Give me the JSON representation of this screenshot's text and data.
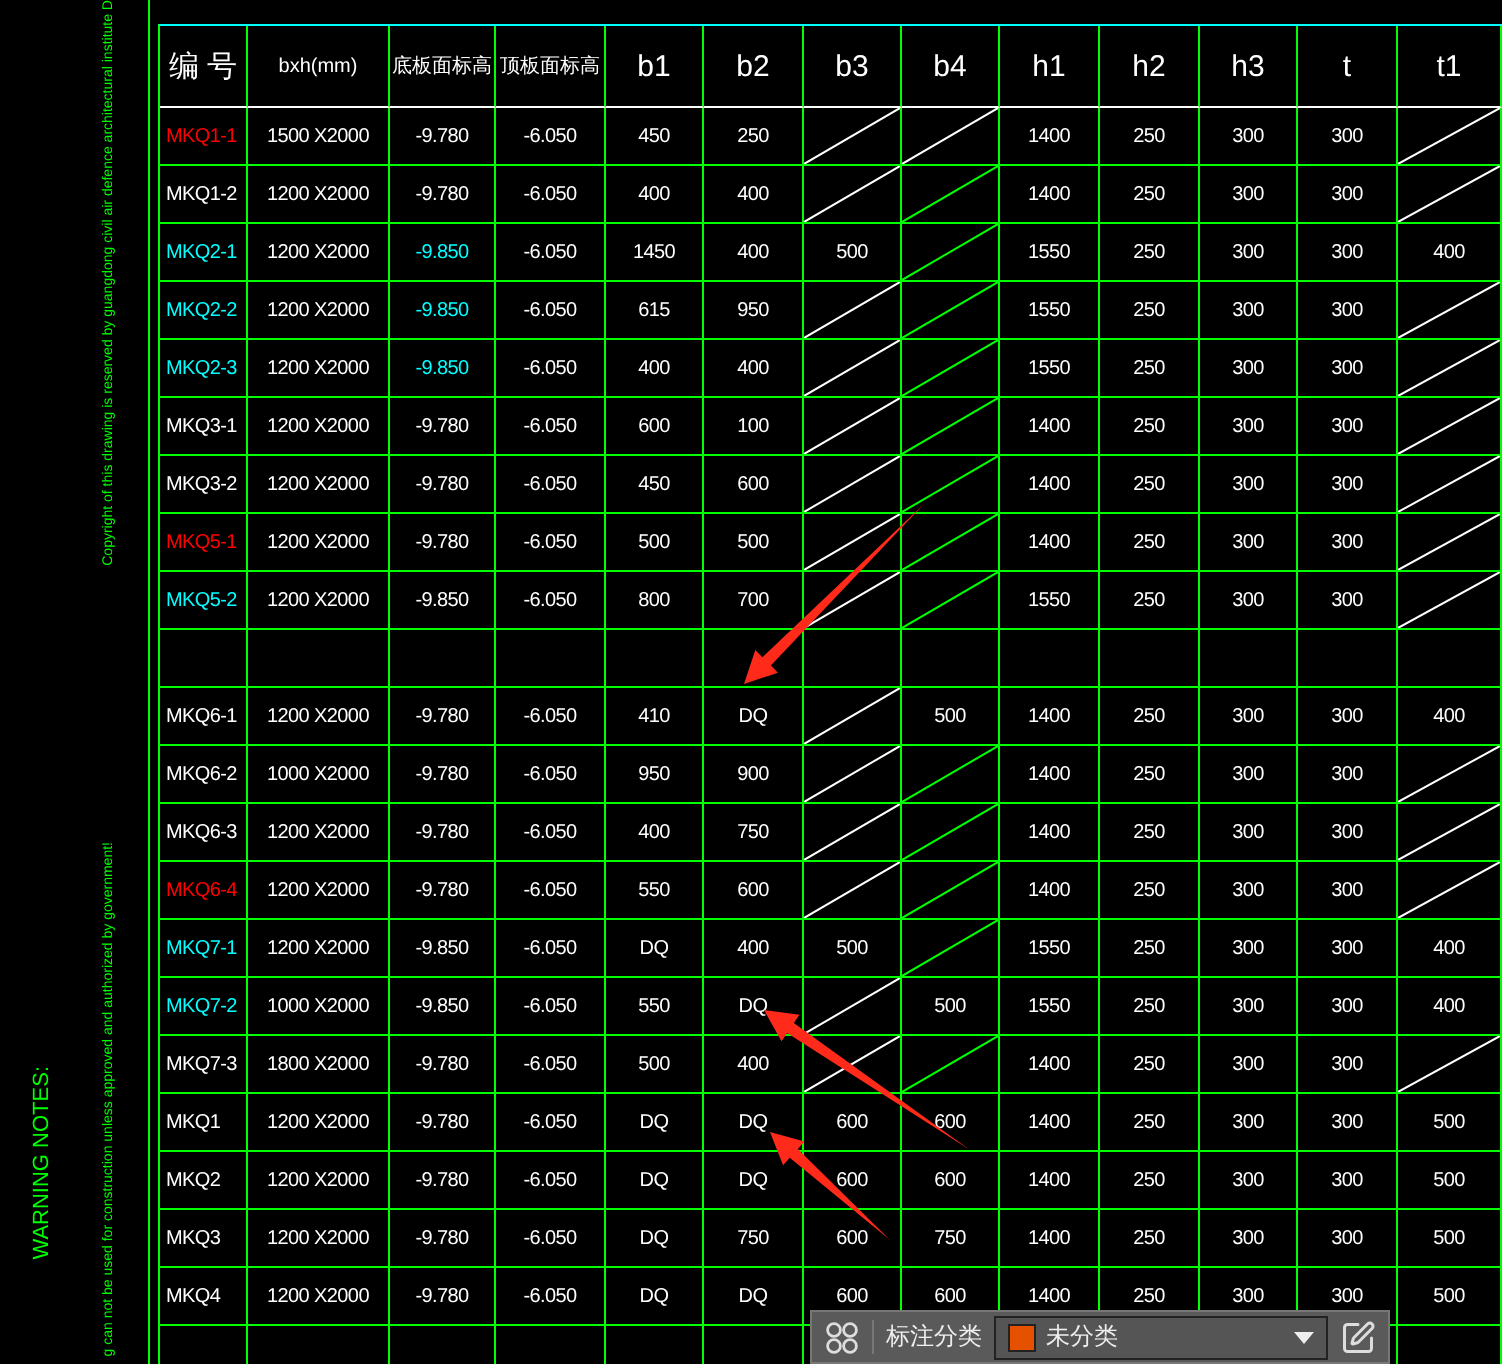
{
  "side_notes": {
    "copyright": "Copyright of this drawing is reserved by guangdong civil air defence architectural institute D",
    "warning_title": "WARNING NOTES:",
    "warning_text": "g can not be used for construction unless approved and authorized by government!"
  },
  "table": {
    "columns": [
      "编 号",
      "bxh(mm)",
      "底板面标高",
      "顶板面标高",
      "b1",
      "b2",
      "b3",
      "b4",
      "h1",
      "h2",
      "h3",
      "t",
      "t1"
    ],
    "rows": [
      {
        "kind": "data",
        "cells": [
          {
            "kind": "text",
            "text": "MKQ1-1",
            "color": "#ff0000"
          },
          {
            "kind": "text",
            "text": "1500 X2000",
            "color": "#ffffff"
          },
          {
            "kind": "text",
            "text": "-9.780",
            "color": "#ffffff"
          },
          {
            "kind": "text",
            "text": "-6.050",
            "color": "#ffffff"
          },
          {
            "kind": "text",
            "text": "450",
            "color": "#ffffff"
          },
          {
            "kind": "text",
            "text": "250",
            "color": "#ffffff"
          },
          {
            "kind": "slash",
            "color": "#ffffff"
          },
          {
            "kind": "slash",
            "color": "#ffffff"
          },
          {
            "kind": "text",
            "text": "1400",
            "color": "#ffffff"
          },
          {
            "kind": "text",
            "text": "250",
            "color": "#ffffff"
          },
          {
            "kind": "text",
            "text": "300",
            "color": "#ffffff"
          },
          {
            "kind": "text",
            "text": "300",
            "color": "#ffffff"
          },
          {
            "kind": "slash",
            "color": "#ffffff"
          }
        ]
      },
      {
        "kind": "data",
        "cells": [
          {
            "kind": "text",
            "text": "MKQ1-2",
            "color": "#ffffff"
          },
          {
            "kind": "text",
            "text": "1200 X2000",
            "color": "#ffffff"
          },
          {
            "kind": "text",
            "text": "-9.780",
            "color": "#ffffff"
          },
          {
            "kind": "text",
            "text": "-6.050",
            "color": "#ffffff"
          },
          {
            "kind": "text",
            "text": "400",
            "color": "#ffffff"
          },
          {
            "kind": "text",
            "text": "400",
            "color": "#ffffff"
          },
          {
            "kind": "slash",
            "color": "#ffffff"
          },
          {
            "kind": "slash",
            "color": "#00ff00"
          },
          {
            "kind": "text",
            "text": "1400",
            "color": "#ffffff"
          },
          {
            "kind": "text",
            "text": "250",
            "color": "#ffffff"
          },
          {
            "kind": "text",
            "text": "300",
            "color": "#ffffff"
          },
          {
            "kind": "text",
            "text": "300",
            "color": "#ffffff"
          },
          {
            "kind": "slash",
            "color": "#ffffff"
          }
        ]
      },
      {
        "kind": "data",
        "cells": [
          {
            "kind": "text",
            "text": "MKQ2-1",
            "color": "#00ffff"
          },
          {
            "kind": "text",
            "text": "1200 X2000",
            "color": "#ffffff"
          },
          {
            "kind": "text",
            "text": "-9.850",
            "color": "#00ffff"
          },
          {
            "kind": "text",
            "text": "-6.050",
            "color": "#ffffff"
          },
          {
            "kind": "text",
            "text": "1450",
            "color": "#ffffff"
          },
          {
            "kind": "text",
            "text": "400",
            "color": "#ffffff"
          },
          {
            "kind": "text",
            "text": "500",
            "color": "#ffffff"
          },
          {
            "kind": "slash",
            "color": "#00ff00"
          },
          {
            "kind": "text",
            "text": "1550",
            "color": "#ffffff"
          },
          {
            "kind": "text",
            "text": "250",
            "color": "#ffffff"
          },
          {
            "kind": "text",
            "text": "300",
            "color": "#ffffff"
          },
          {
            "kind": "text",
            "text": "300",
            "color": "#ffffff"
          },
          {
            "kind": "text",
            "text": "400",
            "color": "#ffffff"
          }
        ]
      },
      {
        "kind": "data",
        "cells": [
          {
            "kind": "text",
            "text": "MKQ2-2",
            "color": "#00ffff"
          },
          {
            "kind": "text",
            "text": "1200 X2000",
            "color": "#ffffff"
          },
          {
            "kind": "text",
            "text": "-9.850",
            "color": "#00ffff"
          },
          {
            "kind": "text",
            "text": "-6.050",
            "color": "#ffffff"
          },
          {
            "kind": "text",
            "text": "615",
            "color": "#ffffff"
          },
          {
            "kind": "text",
            "text": "950",
            "color": "#ffffff"
          },
          {
            "kind": "slash",
            "color": "#ffffff"
          },
          {
            "kind": "slash",
            "color": "#00ff00"
          },
          {
            "kind": "text",
            "text": "1550",
            "color": "#ffffff"
          },
          {
            "kind": "text",
            "text": "250",
            "color": "#ffffff"
          },
          {
            "kind": "text",
            "text": "300",
            "color": "#ffffff"
          },
          {
            "kind": "text",
            "text": "300",
            "color": "#ffffff"
          },
          {
            "kind": "slash",
            "color": "#ffffff"
          }
        ]
      },
      {
        "kind": "data",
        "cells": [
          {
            "kind": "text",
            "text": "MKQ2-3",
            "color": "#00ffff"
          },
          {
            "kind": "text",
            "text": "1200 X2000",
            "color": "#ffffff"
          },
          {
            "kind": "text",
            "text": "-9.850",
            "color": "#00ffff"
          },
          {
            "kind": "text",
            "text": "-6.050",
            "color": "#ffffff"
          },
          {
            "kind": "text",
            "text": "400",
            "color": "#ffffff"
          },
          {
            "kind": "text",
            "text": "400",
            "color": "#ffffff"
          },
          {
            "kind": "slash",
            "color": "#ffffff"
          },
          {
            "kind": "slash",
            "color": "#00ff00"
          },
          {
            "kind": "text",
            "text": "1550",
            "color": "#ffffff"
          },
          {
            "kind": "text",
            "text": "250",
            "color": "#ffffff"
          },
          {
            "kind": "text",
            "text": "300",
            "color": "#ffffff"
          },
          {
            "kind": "text",
            "text": "300",
            "color": "#ffffff"
          },
          {
            "kind": "slash",
            "color": "#ffffff"
          }
        ]
      },
      {
        "kind": "data",
        "cells": [
          {
            "kind": "text",
            "text": "MKQ3-1",
            "color": "#ffffff"
          },
          {
            "kind": "text",
            "text": "1200 X2000",
            "color": "#ffffff"
          },
          {
            "kind": "text",
            "text": "-9.780",
            "color": "#ffffff"
          },
          {
            "kind": "text",
            "text": "-6.050",
            "color": "#ffffff"
          },
          {
            "kind": "text",
            "text": "600",
            "color": "#ffffff"
          },
          {
            "kind": "text",
            "text": "100",
            "color": "#ffffff"
          },
          {
            "kind": "slash",
            "color": "#ffffff"
          },
          {
            "kind": "slash",
            "color": "#00ff00"
          },
          {
            "kind": "text",
            "text": "1400",
            "color": "#ffffff"
          },
          {
            "kind": "text",
            "text": "250",
            "color": "#ffffff"
          },
          {
            "kind": "text",
            "text": "300",
            "color": "#ffffff"
          },
          {
            "kind": "text",
            "text": "300",
            "color": "#ffffff"
          },
          {
            "kind": "slash",
            "color": "#ffffff"
          }
        ]
      },
      {
        "kind": "data",
        "cells": [
          {
            "kind": "text",
            "text": "MKQ3-2",
            "color": "#ffffff"
          },
          {
            "kind": "text",
            "text": "1200 X2000",
            "color": "#ffffff"
          },
          {
            "kind": "text",
            "text": "-9.780",
            "color": "#ffffff"
          },
          {
            "kind": "text",
            "text": "-6.050",
            "color": "#ffffff"
          },
          {
            "kind": "text",
            "text": "450",
            "color": "#ffffff"
          },
          {
            "kind": "text",
            "text": "600",
            "color": "#ffffff"
          },
          {
            "kind": "slash",
            "color": "#ffffff"
          },
          {
            "kind": "slash",
            "color": "#00ff00"
          },
          {
            "kind": "text",
            "text": "1400",
            "color": "#ffffff"
          },
          {
            "kind": "text",
            "text": "250",
            "color": "#ffffff"
          },
          {
            "kind": "text",
            "text": "300",
            "color": "#ffffff"
          },
          {
            "kind": "text",
            "text": "300",
            "color": "#ffffff"
          },
          {
            "kind": "slash",
            "color": "#ffffff"
          }
        ]
      },
      {
        "kind": "data",
        "cells": [
          {
            "kind": "text",
            "text": "MKQ5-1",
            "color": "#ff0000"
          },
          {
            "kind": "text",
            "text": "1200 X2000",
            "color": "#ffffff"
          },
          {
            "kind": "text",
            "text": "-9.780",
            "color": "#ffffff"
          },
          {
            "kind": "text",
            "text": "-6.050",
            "color": "#ffffff"
          },
          {
            "kind": "text",
            "text": "500",
            "color": "#ffffff"
          },
          {
            "kind": "text",
            "text": "500",
            "color": "#ffffff"
          },
          {
            "kind": "slash",
            "color": "#ffffff"
          },
          {
            "kind": "slash",
            "color": "#00ff00"
          },
          {
            "kind": "text",
            "text": "1400",
            "color": "#ffffff"
          },
          {
            "kind": "text",
            "text": "250",
            "color": "#ffffff"
          },
          {
            "kind": "text",
            "text": "300",
            "color": "#ffffff"
          },
          {
            "kind": "text",
            "text": "300",
            "color": "#ffffff"
          },
          {
            "kind": "slash",
            "color": "#ffffff"
          }
        ]
      },
      {
        "kind": "data",
        "cells": [
          {
            "kind": "text",
            "text": "MKQ5-2",
            "color": "#00ffff"
          },
          {
            "kind": "text",
            "text": "1200 X2000",
            "color": "#ffffff"
          },
          {
            "kind": "text",
            "text": "-9.850",
            "color": "#ffffff"
          },
          {
            "kind": "text",
            "text": "-6.050",
            "color": "#ffffff"
          },
          {
            "kind": "text",
            "text": "800",
            "color": "#ffffff"
          },
          {
            "kind": "text",
            "text": "700",
            "color": "#ffffff"
          },
          {
            "kind": "slash",
            "color": "#ffffff"
          },
          {
            "kind": "slash",
            "color": "#00ff00"
          },
          {
            "kind": "text",
            "text": "1550",
            "color": "#ffffff"
          },
          {
            "kind": "text",
            "text": "250",
            "color": "#ffffff"
          },
          {
            "kind": "text",
            "text": "300",
            "color": "#ffffff"
          },
          {
            "kind": "text",
            "text": "300",
            "color": "#ffffff"
          },
          {
            "kind": "slash",
            "color": "#ffffff"
          }
        ]
      },
      {
        "kind": "blank"
      },
      {
        "kind": "data",
        "cells": [
          {
            "kind": "text",
            "text": "MKQ6-1",
            "color": "#ffffff"
          },
          {
            "kind": "text",
            "text": "1200 X2000",
            "color": "#ffffff"
          },
          {
            "kind": "text",
            "text": "-9.780",
            "color": "#ffffff"
          },
          {
            "kind": "text",
            "text": "-6.050",
            "color": "#ffffff"
          },
          {
            "kind": "text",
            "text": "410",
            "color": "#ffffff"
          },
          {
            "kind": "text",
            "text": "DQ",
            "color": "#ffffff"
          },
          {
            "kind": "slash",
            "color": "#ffffff"
          },
          {
            "kind": "text",
            "text": "500",
            "color": "#ffffff"
          },
          {
            "kind": "text",
            "text": "1400",
            "color": "#ffffff"
          },
          {
            "kind": "text",
            "text": "250",
            "color": "#ffffff"
          },
          {
            "kind": "text",
            "text": "300",
            "color": "#ffffff"
          },
          {
            "kind": "text",
            "text": "300",
            "color": "#ffffff"
          },
          {
            "kind": "text",
            "text": "400",
            "color": "#ffffff"
          }
        ]
      },
      {
        "kind": "data",
        "cells": [
          {
            "kind": "text",
            "text": "MKQ6-2",
            "color": "#ffffff"
          },
          {
            "kind": "text",
            "text": "1000 X2000",
            "color": "#ffffff"
          },
          {
            "kind": "text",
            "text": "-9.780",
            "color": "#ffffff"
          },
          {
            "kind": "text",
            "text": "-6.050",
            "color": "#ffffff"
          },
          {
            "kind": "text",
            "text": "950",
            "color": "#ffffff"
          },
          {
            "kind": "text",
            "text": "900",
            "color": "#ffffff"
          },
          {
            "kind": "slash",
            "color": "#ffffff"
          },
          {
            "kind": "slash",
            "color": "#00ff00"
          },
          {
            "kind": "text",
            "text": "1400",
            "color": "#ffffff"
          },
          {
            "kind": "text",
            "text": "250",
            "color": "#ffffff"
          },
          {
            "kind": "text",
            "text": "300",
            "color": "#ffffff"
          },
          {
            "kind": "text",
            "text": "300",
            "color": "#ffffff"
          },
          {
            "kind": "slash",
            "color": "#ffffff"
          }
        ]
      },
      {
        "kind": "data",
        "cells": [
          {
            "kind": "text",
            "text": "MKQ6-3",
            "color": "#ffffff"
          },
          {
            "kind": "text",
            "text": "1200 X2000",
            "color": "#ffffff"
          },
          {
            "kind": "text",
            "text": "-9.780",
            "color": "#ffffff"
          },
          {
            "kind": "text",
            "text": "-6.050",
            "color": "#ffffff"
          },
          {
            "kind": "text",
            "text": "400",
            "color": "#ffffff"
          },
          {
            "kind": "text",
            "text": "750",
            "color": "#ffffff"
          },
          {
            "kind": "slash",
            "color": "#ffffff"
          },
          {
            "kind": "slash",
            "color": "#00ff00"
          },
          {
            "kind": "text",
            "text": "1400",
            "color": "#ffffff"
          },
          {
            "kind": "text",
            "text": "250",
            "color": "#ffffff"
          },
          {
            "kind": "text",
            "text": "300",
            "color": "#ffffff"
          },
          {
            "kind": "text",
            "text": "300",
            "color": "#ffffff"
          },
          {
            "kind": "slash",
            "color": "#ffffff"
          }
        ]
      },
      {
        "kind": "data",
        "cells": [
          {
            "kind": "text",
            "text": "MKQ6-4",
            "color": "#ff0000"
          },
          {
            "kind": "text",
            "text": "1200 X2000",
            "color": "#ffffff"
          },
          {
            "kind": "text",
            "text": "-9.780",
            "color": "#ffffff"
          },
          {
            "kind": "text",
            "text": "-6.050",
            "color": "#ffffff"
          },
          {
            "kind": "text",
            "text": "550",
            "color": "#ffffff"
          },
          {
            "kind": "text",
            "text": "600",
            "color": "#ffffff"
          },
          {
            "kind": "slash",
            "color": "#ffffff"
          },
          {
            "kind": "slash",
            "color": "#00ff00"
          },
          {
            "kind": "text",
            "text": "1400",
            "color": "#ffffff"
          },
          {
            "kind": "text",
            "text": "250",
            "color": "#ffffff"
          },
          {
            "kind": "text",
            "text": "300",
            "color": "#ffffff"
          },
          {
            "kind": "text",
            "text": "300",
            "color": "#ffffff"
          },
          {
            "kind": "slash",
            "color": "#ffffff"
          }
        ]
      },
      {
        "kind": "data",
        "cells": [
          {
            "kind": "text",
            "text": "MKQ7-1",
            "color": "#00ffff"
          },
          {
            "kind": "text",
            "text": "1200 X2000",
            "color": "#ffffff"
          },
          {
            "kind": "text",
            "text": "-9.850",
            "color": "#ffffff"
          },
          {
            "kind": "text",
            "text": "-6.050",
            "color": "#ffffff"
          },
          {
            "kind": "text",
            "text": "DQ",
            "color": "#ffffff"
          },
          {
            "kind": "text",
            "text": "400",
            "color": "#ffffff"
          },
          {
            "kind": "text",
            "text": "500",
            "color": "#ffffff"
          },
          {
            "kind": "slash",
            "color": "#00ff00"
          },
          {
            "kind": "text",
            "text": "1550",
            "color": "#ffffff"
          },
          {
            "kind": "text",
            "text": "250",
            "color": "#ffffff"
          },
          {
            "kind": "text",
            "text": "300",
            "color": "#ffffff"
          },
          {
            "kind": "text",
            "text": "300",
            "color": "#ffffff"
          },
          {
            "kind": "text",
            "text": "400",
            "color": "#ffffff"
          }
        ]
      },
      {
        "kind": "data",
        "cells": [
          {
            "kind": "text",
            "text": "MKQ7-2",
            "color": "#00ffff"
          },
          {
            "kind": "text",
            "text": "1000 X2000",
            "color": "#ffffff"
          },
          {
            "kind": "text",
            "text": "-9.850",
            "color": "#ffffff"
          },
          {
            "kind": "text",
            "text": "-6.050",
            "color": "#ffffff"
          },
          {
            "kind": "text",
            "text": "550",
            "color": "#ffffff"
          },
          {
            "kind": "text",
            "text": "DQ",
            "color": "#ffffff"
          },
          {
            "kind": "slash",
            "color": "#ffffff"
          },
          {
            "kind": "text",
            "text": "500",
            "color": "#ffffff"
          },
          {
            "kind": "text",
            "text": "1550",
            "color": "#ffffff"
          },
          {
            "kind": "text",
            "text": "250",
            "color": "#ffffff"
          },
          {
            "kind": "text",
            "text": "300",
            "color": "#ffffff"
          },
          {
            "kind": "text",
            "text": "300",
            "color": "#ffffff"
          },
          {
            "kind": "text",
            "text": "400",
            "color": "#ffffff"
          }
        ]
      },
      {
        "kind": "data",
        "cells": [
          {
            "kind": "text",
            "text": "MKQ7-3",
            "color": "#ffffff"
          },
          {
            "kind": "text",
            "text": "1800 X2000",
            "color": "#ffffff"
          },
          {
            "kind": "text",
            "text": "-9.780",
            "color": "#ffffff"
          },
          {
            "kind": "text",
            "text": "-6.050",
            "color": "#ffffff"
          },
          {
            "kind": "text",
            "text": "500",
            "color": "#ffffff"
          },
          {
            "kind": "text",
            "text": "400",
            "color": "#ffffff"
          },
          {
            "kind": "slash",
            "color": "#ffffff"
          },
          {
            "kind": "slash",
            "color": "#00ff00"
          },
          {
            "kind": "text",
            "text": "1400",
            "color": "#ffffff"
          },
          {
            "kind": "text",
            "text": "250",
            "color": "#ffffff"
          },
          {
            "kind": "text",
            "text": "300",
            "color": "#ffffff"
          },
          {
            "kind": "text",
            "text": "300",
            "color": "#ffffff"
          },
          {
            "kind": "slash",
            "color": "#ffffff"
          }
        ]
      },
      {
        "kind": "data",
        "cells": [
          {
            "kind": "text",
            "text": "MKQ1",
            "color": "#ffffff"
          },
          {
            "kind": "text",
            "text": "1200 X2000",
            "color": "#ffffff"
          },
          {
            "kind": "text",
            "text": "-9.780",
            "color": "#ffffff"
          },
          {
            "kind": "text",
            "text": "-6.050",
            "color": "#ffffff"
          },
          {
            "kind": "text",
            "text": "DQ",
            "color": "#ffffff"
          },
          {
            "kind": "text",
            "text": "DQ",
            "color": "#ffffff"
          },
          {
            "kind": "text",
            "text": "600",
            "color": "#ffffff"
          },
          {
            "kind": "text",
            "text": "600",
            "color": "#ffffff"
          },
          {
            "kind": "text",
            "text": "1400",
            "color": "#ffffff"
          },
          {
            "kind": "text",
            "text": "250",
            "color": "#ffffff"
          },
          {
            "kind": "text",
            "text": "300",
            "color": "#ffffff"
          },
          {
            "kind": "text",
            "text": "300",
            "color": "#ffffff"
          },
          {
            "kind": "text",
            "text": "500",
            "color": "#ffffff"
          }
        ]
      },
      {
        "kind": "data",
        "cells": [
          {
            "kind": "text",
            "text": "MKQ2",
            "color": "#ffffff"
          },
          {
            "kind": "text",
            "text": "1200 X2000",
            "color": "#ffffff"
          },
          {
            "kind": "text",
            "text": "-9.780",
            "color": "#ffffff"
          },
          {
            "kind": "text",
            "text": "-6.050",
            "color": "#ffffff"
          },
          {
            "kind": "text",
            "text": "DQ",
            "color": "#ffffff"
          },
          {
            "kind": "text",
            "text": "DQ",
            "color": "#ffffff"
          },
          {
            "kind": "text",
            "text": "600",
            "color": "#ffffff"
          },
          {
            "kind": "text",
            "text": "600",
            "color": "#ffffff"
          },
          {
            "kind": "text",
            "text": "1400",
            "color": "#ffffff"
          },
          {
            "kind": "text",
            "text": "250",
            "color": "#ffffff"
          },
          {
            "kind": "text",
            "text": "300",
            "color": "#ffffff"
          },
          {
            "kind": "text",
            "text": "300",
            "color": "#ffffff"
          },
          {
            "kind": "text",
            "text": "500",
            "color": "#ffffff"
          }
        ]
      },
      {
        "kind": "data",
        "cells": [
          {
            "kind": "text",
            "text": "MKQ3",
            "color": "#ffffff"
          },
          {
            "kind": "text",
            "text": "1200 X2000",
            "color": "#ffffff"
          },
          {
            "kind": "text",
            "text": "-9.780",
            "color": "#ffffff"
          },
          {
            "kind": "text",
            "text": "-6.050",
            "color": "#ffffff"
          },
          {
            "kind": "text",
            "text": "DQ",
            "color": "#ffffff"
          },
          {
            "kind": "text",
            "text": "750",
            "color": "#ffffff"
          },
          {
            "kind": "text",
            "text": "600",
            "color": "#ffffff"
          },
          {
            "kind": "text",
            "text": "750",
            "color": "#ffffff"
          },
          {
            "kind": "text",
            "text": "1400",
            "color": "#ffffff"
          },
          {
            "kind": "text",
            "text": "250",
            "color": "#ffffff"
          },
          {
            "kind": "text",
            "text": "300",
            "color": "#ffffff"
          },
          {
            "kind": "text",
            "text": "300",
            "color": "#ffffff"
          },
          {
            "kind": "text",
            "text": "500",
            "color": "#ffffff"
          }
        ]
      },
      {
        "kind": "data",
        "cells": [
          {
            "kind": "text",
            "text": "MKQ4",
            "color": "#ffffff"
          },
          {
            "kind": "text",
            "text": "1200 X2000",
            "color": "#ffffff"
          },
          {
            "kind": "text",
            "text": "-9.780",
            "color": "#ffffff"
          },
          {
            "kind": "text",
            "text": "-6.050",
            "color": "#ffffff"
          },
          {
            "kind": "text",
            "text": "DQ",
            "color": "#ffffff"
          },
          {
            "kind": "text",
            "text": "DQ",
            "color": "#ffffff"
          },
          {
            "kind": "text",
            "text": "600",
            "color": "#ffffff"
          },
          {
            "kind": "text",
            "text": "600",
            "color": "#ffffff"
          },
          {
            "kind": "text",
            "text": "1400",
            "color": "#ffffff"
          },
          {
            "kind": "text",
            "text": "250",
            "color": "#ffffff"
          },
          {
            "kind": "text",
            "text": "300",
            "color": "#ffffff"
          },
          {
            "kind": "text",
            "text": "300",
            "color": "#ffffff"
          },
          {
            "kind": "text",
            "text": "500",
            "color": "#ffffff"
          }
        ]
      },
      {
        "kind": "blank"
      }
    ]
  },
  "toolbar": {
    "label": "标注分类",
    "dropdown": {
      "value": "未分类",
      "color": "#e65100"
    }
  }
}
